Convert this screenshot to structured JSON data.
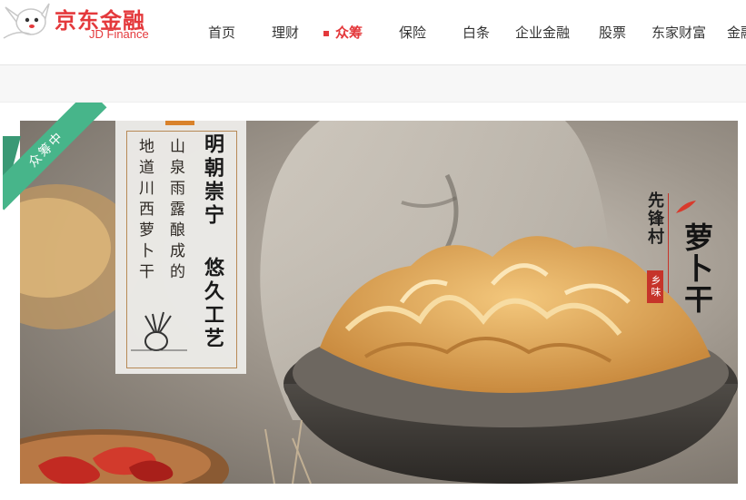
{
  "logo": {
    "cn": "京东金融",
    "en": "JD Finance"
  },
  "nav": {
    "items": [
      {
        "label": "首页"
      },
      {
        "label": "理财"
      },
      {
        "label": "众筹"
      },
      {
        "label": "保险"
      },
      {
        "label": "白条"
      },
      {
        "label": "企业金融"
      },
      {
        "label": "股票"
      },
      {
        "label": "东家财富"
      },
      {
        "label": "金融"
      }
    ],
    "active_index": 2
  },
  "banner": {
    "ribbon": "众筹中",
    "poem": {
      "title_col1": "明朝崇宁",
      "title_col2": "悠久工艺",
      "line1": "山泉雨露酿成的",
      "line2": "地道川西萝卜干"
    },
    "right": {
      "small": "先锋村",
      "big": "萝卜干",
      "stamp": "乡味"
    }
  },
  "colors": {
    "brand": "#e4393c",
    "ribbon": "#47b58a",
    "text": "#333333"
  }
}
